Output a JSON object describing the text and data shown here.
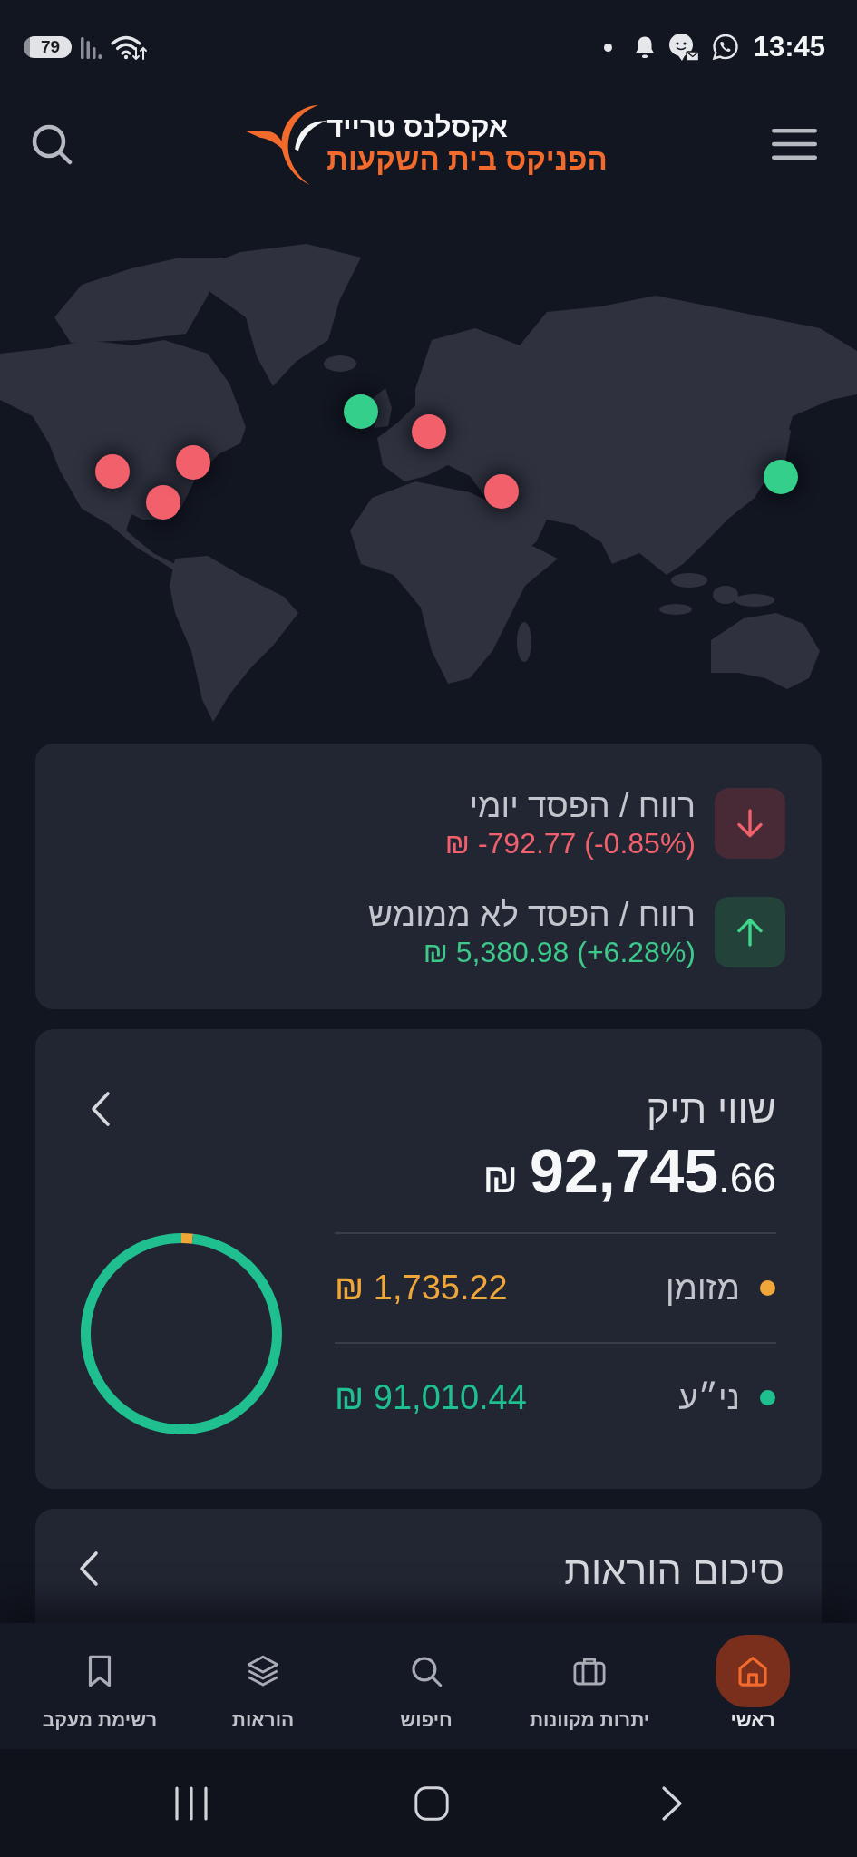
{
  "status_bar": {
    "battery": "79",
    "time": "13:45"
  },
  "header": {
    "logo_title": "אקסלנס טרייד",
    "logo_subtitle": "הפניקס בית השקעות"
  },
  "map": {
    "markers": [
      {
        "color": "#f2606c"
      },
      {
        "color": "#f2606c"
      },
      {
        "color": "#f2606c"
      },
      {
        "color": "#35cf8c"
      },
      {
        "color": "#f2606c"
      },
      {
        "color": "#f2606c"
      },
      {
        "color": "#35cf8c"
      }
    ]
  },
  "pnl": [
    {
      "kind": "loss",
      "title": "רווח / הפסד יומי",
      "value": "₪ -792.77 (-0.85%)"
    },
    {
      "kind": "gain",
      "title": "רווח / הפסד לא ממומש",
      "value": "₪ 5,380.98 (+6.28%)"
    }
  ],
  "portfolio": {
    "title": "שווי תיק",
    "total": "₪ **92,745**.66",
    "holdings": [
      {
        "label": "מזומן",
        "value": "₪ 1,735.22",
        "color": "#f0a73a"
      },
      {
        "label": "ני״ע",
        "value": "₪ 91,010.44",
        "color": "#1fbf8f"
      }
    ],
    "chart_data": {
      "type": "donut",
      "values": [
        1.87,
        98.13
      ]
    }
  },
  "orders_summary": {
    "title": "סיכום הוראות"
  },
  "bottom_nav": {
    "items": [
      {
        "label": "ראשי",
        "selected": true
      },
      {
        "label": "יתרות מקוונות",
        "selected": false
      },
      {
        "label": "חיפוש",
        "selected": false
      },
      {
        "label": "הוראות",
        "selected": false
      },
      {
        "label": "רשימת מעקב",
        "selected": false
      }
    ]
  }
}
